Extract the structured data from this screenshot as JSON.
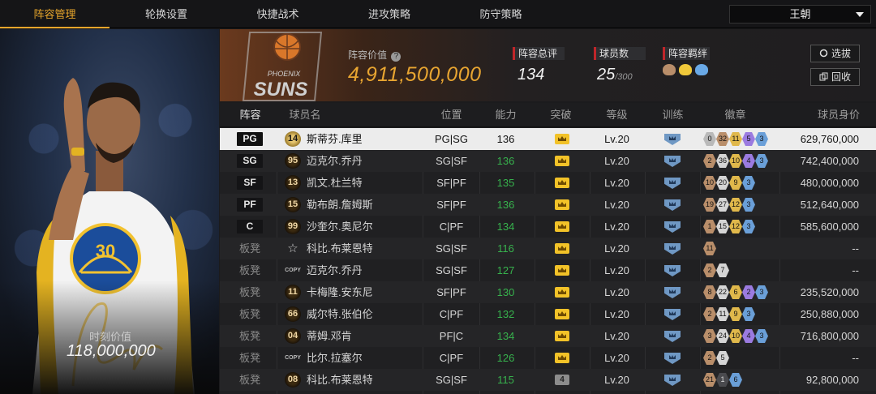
{
  "nav": {
    "tabs": [
      "阵容管理",
      "轮换设置",
      "快捷战术",
      "进攻策略",
      "防守策略"
    ],
    "team_select": "王朝"
  },
  "card": {
    "jersey_number": "30",
    "label": "时刻价值",
    "value": "118,000,000"
  },
  "header": {
    "value_label": "阵容价值",
    "value": "4,911,500,000",
    "overall_label": "阵容总评",
    "overall": "134",
    "players_label": "球员数",
    "players": "25",
    "players_max": "/300",
    "chem_label": "阵容羁绊",
    "btn_pick": "选拔",
    "btn_recycle": "回收"
  },
  "table": {
    "headers": [
      "阵容",
      "球员名",
      "位置",
      "能力",
      "突破",
      "等级",
      "训练",
      "徽章",
      "球员身价"
    ],
    "rows": [
      {
        "slot": "PG",
        "bench": false,
        "no": "14",
        "name": "斯蒂芬.库里",
        "pos": "PG|SG",
        "ovr": "136",
        "brk": "crown",
        "lv": "Lv.20",
        "badges": [
          [
            "0",
            "b-grey"
          ],
          [
            "32",
            "b-bronze"
          ],
          [
            "11",
            "b-gold"
          ],
          [
            "5",
            "b-purple"
          ],
          [
            "3",
            "b-blue"
          ]
        ],
        "price": "629,760,000"
      },
      {
        "slot": "SG",
        "bench": false,
        "no": "95",
        "name": "迈克尔.乔丹",
        "pos": "SG|SF",
        "ovr": "136",
        "brk": "crown",
        "lv": "Lv.20",
        "badges": [
          [
            "2",
            "b-bronze"
          ],
          [
            "36",
            "b-silver"
          ],
          [
            "10",
            "b-gold"
          ],
          [
            "4",
            "b-purple"
          ],
          [
            "3",
            "b-blue"
          ]
        ],
        "price": "742,400,000"
      },
      {
        "slot": "SF",
        "bench": false,
        "no": "13",
        "name": "凯文.杜兰特",
        "pos": "SF|PF",
        "ovr": "135",
        "brk": "crown",
        "lv": "Lv.20",
        "badges": [
          [
            "10",
            "b-bronze"
          ],
          [
            "20",
            "b-silver"
          ],
          [
            "9",
            "b-gold"
          ],
          [
            "3",
            "b-blue"
          ]
        ],
        "price": "480,000,000"
      },
      {
        "slot": "PF",
        "bench": false,
        "no": "15",
        "name": "勒布朗.詹姆斯",
        "pos": "SF|PF",
        "ovr": "136",
        "brk": "crown",
        "lv": "Lv.20",
        "badges": [
          [
            "19",
            "b-bronze"
          ],
          [
            "27",
            "b-silver"
          ],
          [
            "12",
            "b-gold"
          ],
          [
            "3",
            "b-blue"
          ]
        ],
        "price": "512,640,000"
      },
      {
        "slot": "C",
        "bench": false,
        "no": "99",
        "name": "沙奎尔.奥尼尔",
        "pos": "C|PF",
        "ovr": "134",
        "brk": "crown",
        "lv": "Lv.20",
        "badges": [
          [
            "1",
            "b-bronze"
          ],
          [
            "15",
            "b-silver"
          ],
          [
            "12",
            "b-gold"
          ],
          [
            "3",
            "b-blue"
          ]
        ],
        "price": "585,600,000"
      },
      {
        "slot": "板凳",
        "bench": true,
        "no": "☆",
        "name": "科比.布莱恩特",
        "pos": "SG|SF",
        "ovr": "116",
        "brk": "crown",
        "lv": "Lv.20",
        "badges": [
          [
            "11",
            "b-bronze"
          ]
        ],
        "price": "--"
      },
      {
        "slot": "板凳",
        "bench": true,
        "no": "COPY",
        "name": "迈克尔.乔丹",
        "pos": "SG|SF",
        "ovr": "127",
        "brk": "crown",
        "lv": "Lv.20",
        "badges": [
          [
            "2",
            "b-bronze"
          ],
          [
            "7",
            "b-silver"
          ]
        ],
        "price": "--"
      },
      {
        "slot": "板凳",
        "bench": true,
        "no": "11",
        "name": "卡梅隆.安东尼",
        "pos": "SF|PF",
        "ovr": "130",
        "brk": "crown",
        "lv": "Lv.20",
        "badges": [
          [
            "8",
            "b-bronze"
          ],
          [
            "22",
            "b-silver"
          ],
          [
            "6",
            "b-gold"
          ],
          [
            "2",
            "b-purple"
          ],
          [
            "3",
            "b-blue"
          ]
        ],
        "price": "235,520,000"
      },
      {
        "slot": "板凳",
        "bench": true,
        "no": "66",
        "name": "威尔特.张伯伦",
        "pos": "C|PF",
        "ovr": "132",
        "brk": "crown",
        "lv": "Lv.20",
        "badges": [
          [
            "2",
            "b-bronze"
          ],
          [
            "11",
            "b-silver"
          ],
          [
            "9",
            "b-gold"
          ],
          [
            "3",
            "b-blue"
          ]
        ],
        "price": "250,880,000"
      },
      {
        "slot": "板凳",
        "bench": true,
        "no": "04",
        "name": "蒂姆.邓肯",
        "pos": "PF|C",
        "ovr": "134",
        "brk": "crown",
        "lv": "Lv.20",
        "badges": [
          [
            "3",
            "b-bronze"
          ],
          [
            "24",
            "b-silver"
          ],
          [
            "10",
            "b-gold"
          ],
          [
            "4",
            "b-purple"
          ],
          [
            "3",
            "b-blue"
          ]
        ],
        "price": "716,800,000"
      },
      {
        "slot": "板凳",
        "bench": true,
        "no": "COPY",
        "name": "比尔.拉塞尔",
        "pos": "C|PF",
        "ovr": "126",
        "brk": "crown",
        "lv": "Lv.20",
        "badges": [
          [
            "2",
            "b-bronze"
          ],
          [
            "5",
            "b-silver"
          ]
        ],
        "price": "--"
      },
      {
        "slot": "板凳",
        "bench": true,
        "no": "08",
        "name": "科比.布莱恩特",
        "pos": "SG|SF",
        "ovr": "115",
        "brk": "4",
        "lv": "Lv.20",
        "badges": [
          [
            "21",
            "b-bronze"
          ],
          [
            "1",
            "b-dark"
          ],
          [
            "6",
            "b-blue"
          ]
        ],
        "price": "92,800,000"
      }
    ]
  }
}
